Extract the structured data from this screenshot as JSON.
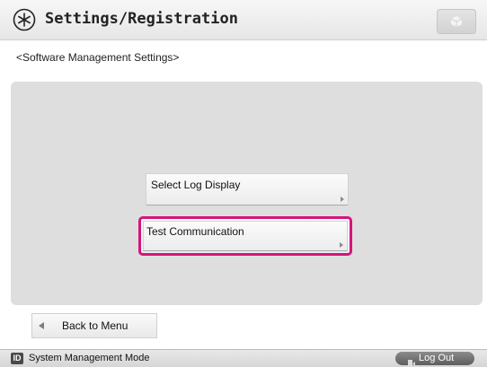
{
  "header": {
    "title": "Settings/Registration",
    "icon": "settings-star-icon",
    "right_icon": "cube-icon"
  },
  "breadcrumb": "<Software Management Settings>",
  "menu": {
    "items": [
      {
        "label": "Select Log Display",
        "selected": false
      },
      {
        "label": "Test Communication",
        "selected": true
      }
    ]
  },
  "back_button": {
    "label": "Back to Menu",
    "icon": "back-arrow-icon"
  },
  "status_bar": {
    "badge": "ID",
    "text": "System Management Mode",
    "logout_label": "Log Out",
    "logout_icon": "logout-door-icon"
  },
  "colors": {
    "selection_highlight": "#d4147c",
    "panel_background": "#dedede"
  }
}
